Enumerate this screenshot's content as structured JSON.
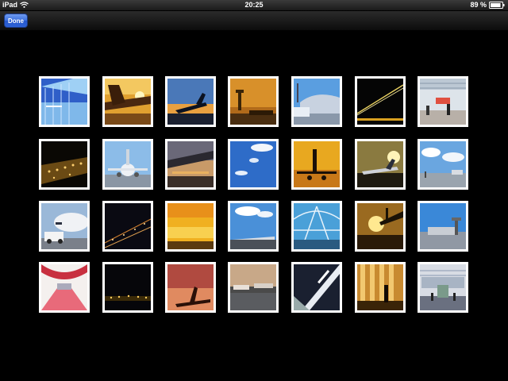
{
  "status_bar": {
    "device": "iPad",
    "time": "20:25",
    "battery": "89 %",
    "battery_level": 0.89
  },
  "toolbar": {
    "done_label": "Done"
  },
  "photos": [
    "airport-terminal-blue-glass",
    "airplane-tail-sunset",
    "airplane-takeoff-dusk",
    "control-tower-orange-sky",
    "terminal-building-blue-sky",
    "night-light-trail",
    "terminal-interior-crowd",
    "night-airport-aerial",
    "airplane-front-blue-sky",
    "terminal-roof-dusk",
    "blue-sky-clouds",
    "airplane-silhouette-golden",
    "airplane-taxi-sunset",
    "airport-tarmac-clouds",
    "airplane-nose-tug",
    "night-runway-lights",
    "golden-sky-horizon",
    "clouds-terminal-rooftop",
    "glass-atrium-blue",
    "airplane-sunburst",
    "terminal-tower-blue-sky",
    "red-tunnel-corridor",
    "night-airport-lights",
    "red-sky-airplane-tail",
    "tarmac-evening",
    "terminal-canopy-sign",
    "golden-hallway-silhouette",
    "terminal-hall-interior"
  ]
}
